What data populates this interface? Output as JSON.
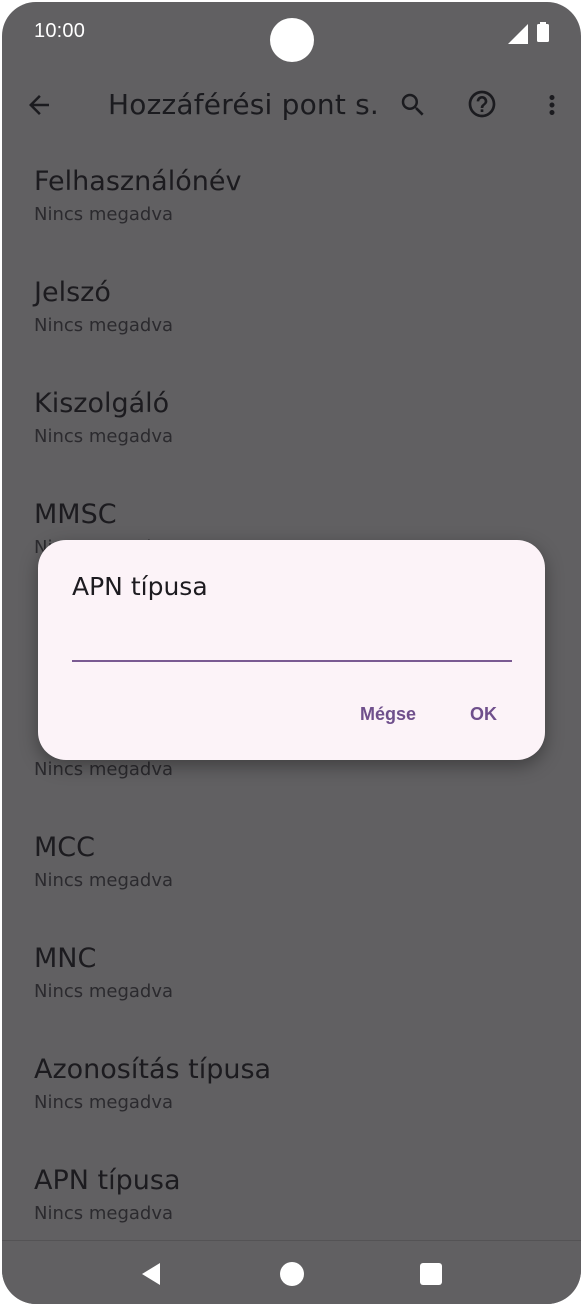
{
  "status_bar": {
    "time": "10:00"
  },
  "app_bar": {
    "title": "Hozzáférési pont s...",
    "icons": [
      "arrow-back-icon",
      "search-icon",
      "help-icon",
      "more-vert-icon"
    ]
  },
  "settings": {
    "items": [
      {
        "title": "Felhasználónév",
        "subtitle": "Nincs megadva"
      },
      {
        "title": "Jelszó",
        "subtitle": "Nincs megadva"
      },
      {
        "title": "Kiszolgáló",
        "subtitle": "Nincs megadva"
      },
      {
        "title": "MMSC",
        "subtitle": "Nincs megadva"
      },
      {
        "title": "",
        "subtitle": ""
      },
      {
        "title": "",
        "subtitle": "Nincs megadva"
      },
      {
        "title": "MCC",
        "subtitle": "Nincs megadva"
      },
      {
        "title": "MNC",
        "subtitle": "Nincs megadva"
      },
      {
        "title": "Azonosítás típusa",
        "subtitle": "Nincs megadva"
      },
      {
        "title": "APN típusa",
        "subtitle": "Nincs megadva"
      }
    ]
  },
  "dialog": {
    "title": "APN típusa",
    "input_value": "",
    "cancel_label": "Mégse",
    "ok_label": "OK"
  },
  "nav_bar": {
    "icons": [
      "nav-back-icon",
      "nav-home-icon",
      "nav-recents-icon"
    ]
  },
  "colors": {
    "scrim_background": "#616062",
    "dialog_background": "#fcf3f8",
    "accent": "#6f4f8c"
  }
}
